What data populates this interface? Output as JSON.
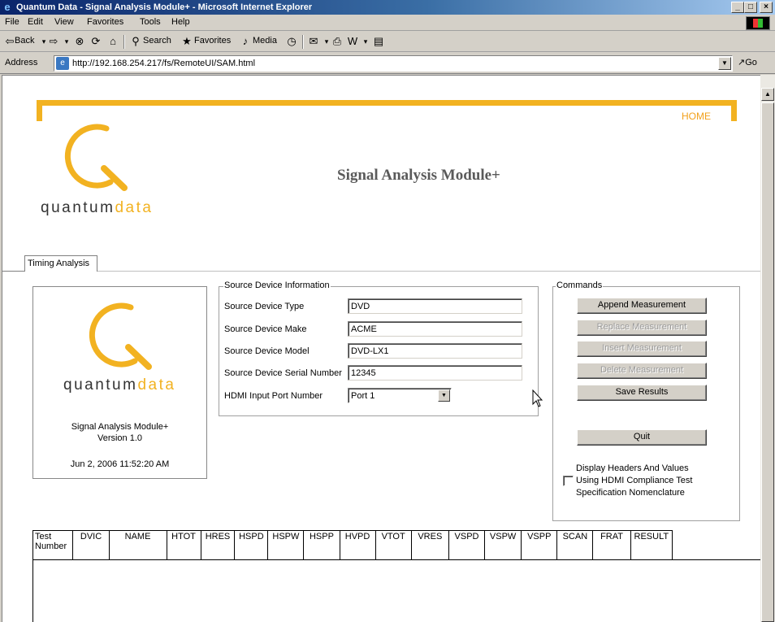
{
  "window": {
    "title": "Quantum Data - Signal Analysis Module+ - Microsoft Internet Explorer",
    "minimize": "_",
    "maximize": "□",
    "close": "×"
  },
  "menu": [
    "File",
    "Edit",
    "View",
    "Favorites",
    "Tools",
    "Help"
  ],
  "toolbar": {
    "back": "Back",
    "search": "Search",
    "favorites": "Favorites",
    "media": "Media"
  },
  "address": {
    "label": "Address",
    "url": "http://192.168.254.217/fs/RemoteUI/SAM.html",
    "go": "Go"
  },
  "header": {
    "home": "HOME",
    "title": "Signal Analysis Module+",
    "logo_quantum": "quantum",
    "logo_data": "data"
  },
  "tabs": [
    "Timing Analysis"
  ],
  "info_box": {
    "logo_quantum": "quantum",
    "logo_data": "data",
    "title": "Signal Analysis Module+",
    "version": "Version 1.0",
    "date": "Jun 2, 2006 11:52:20 AM"
  },
  "source_device": {
    "legend": "Source Device Information",
    "fields": [
      {
        "label": "Source Device Type",
        "value": "DVD"
      },
      {
        "label": "Source Device Make",
        "value": "ACME"
      },
      {
        "label": "Source Device Model",
        "value": "DVD-LX1"
      },
      {
        "label": "Source Device Serial Number",
        "value": "12345"
      }
    ],
    "port_label": "HDMI Input Port Number",
    "port_value": "Port 1"
  },
  "commands": {
    "legend": "Commands",
    "append": "Append Measurement",
    "replace": "Replace Measurement",
    "insert": "Insert Measurement",
    "delete": "Delete Measurement",
    "save": "Save Results",
    "quit": "Quit",
    "checkbox_line1": "Display Headers And Values",
    "checkbox_line2": "Using HDMI Compliance Test",
    "checkbox_line3": "Specification Nomenclature",
    "checkbox_checked": false
  },
  "table": {
    "headers": [
      "Test Number",
      "DVIC",
      "NAME",
      "HTOT",
      "HRES",
      "HSPD",
      "HSPW",
      "HSPP",
      "HVPD",
      "VTOT",
      "VRES",
      "VSPD",
      "VSPW",
      "VSPP",
      "SCAN",
      "FRAT",
      "RESULT"
    ]
  }
}
